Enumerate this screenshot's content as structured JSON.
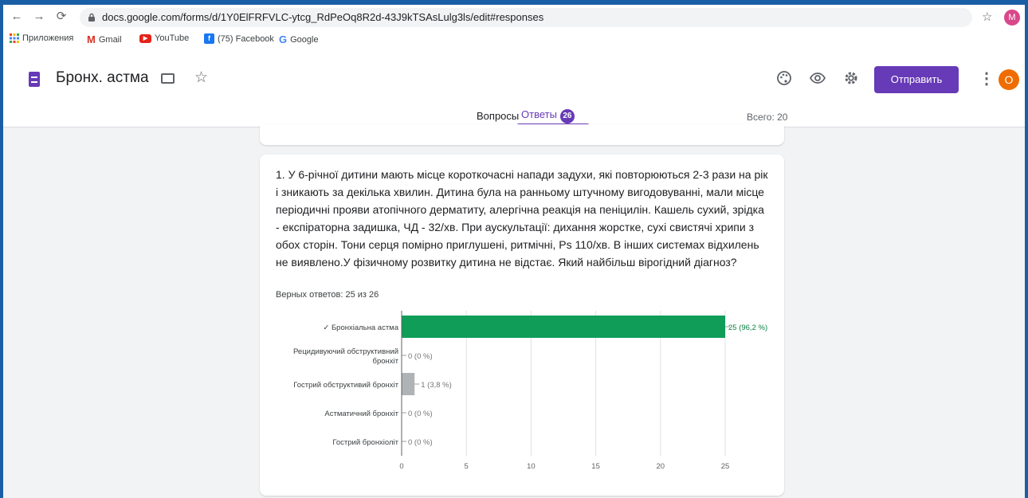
{
  "browser": {
    "url": "docs.google.com/forms/d/1Y0ElFRFVLC-ytcg_RdPeOq8R2d-43J9kTSAsLulg3ls/edit#responses",
    "profile_initial": "M",
    "bookmarks": [
      {
        "label": "Приложения",
        "icon": "apps-grid-icon"
      },
      {
        "label": "Gmail",
        "icon": "gmail-icon"
      },
      {
        "label": "YouTube",
        "icon": "youtube-icon"
      },
      {
        "label": "(75) Facebook",
        "icon": "facebook-icon"
      },
      {
        "label": "Google",
        "icon": "google-icon"
      }
    ]
  },
  "form": {
    "title": "Бронх. астма",
    "send_label": "Отправить",
    "avatar_initial": "O",
    "tabs": {
      "questions": "Вопросы",
      "responses": "Ответы",
      "responses_count": "26"
    },
    "total_label": "Всего: 20",
    "accent_color": "#673ab7"
  },
  "question": {
    "text": "1. У 6-річної дитини мають місце короткочасні напади задухи, які повторюються 2-3 рази на рік і зникають за декілька хвилин. Дитина була на ранньому штучному вигодовуванні, мали місце періодичні прояви атопічного дерматиту, алергічна реакція на пеніцилін. Кашель сухий, зрідка - експіраторна задишка, ЧД - 32/хв. При аускультації: дихання жорстке, сухі свистячі хрипи з обох сторін. Тони серця помірно приглушені, ритмічні, Ps 110/хв. В інших системах відхилень не виявлено.У фізичному розвитку дитина не відстає. Який найбільш вірогідний діагноз?",
    "correct_label": "Верных ответов: 25 из 26"
  },
  "chart_data": {
    "type": "bar",
    "orientation": "horizontal",
    "categories": [
      [
        "✓ Бронхіальна астма"
      ],
      [
        "Рецидивуючий обструктивний",
        "бронхіт"
      ],
      [
        "Гострий обструктивий бронхіт"
      ],
      [
        "Астматичний бронхіт"
      ],
      [
        "Гострий бронхіоліт"
      ]
    ],
    "values": [
      25,
      0,
      1,
      0,
      0
    ],
    "value_labels": [
      "25 (96,2 %)",
      "0 (0 %)",
      "1 (3,8 %)",
      "0 (0 %)",
      "0 (0 %)"
    ],
    "bar_colors": [
      "#0f9d58",
      "#bdbdbd",
      "#b0b3b6",
      "#bdbdbd",
      "#bdbdbd"
    ],
    "x_ticks": [
      0,
      5,
      10,
      15,
      20,
      25
    ],
    "xlim": [
      0,
      25
    ],
    "grid": true
  }
}
